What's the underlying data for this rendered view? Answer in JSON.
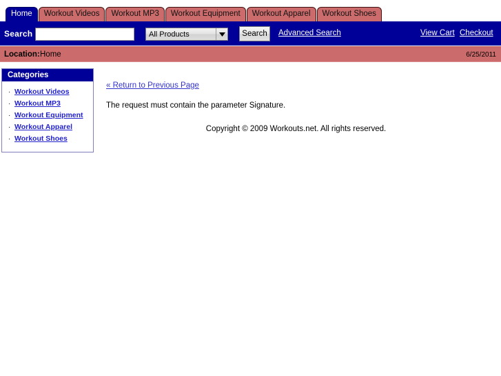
{
  "colors": {
    "navy": "#000099",
    "rose": "#cc6b6b",
    "link_blue": "#2222cc",
    "white": "#ffffff"
  },
  "tabs": [
    {
      "label": "Home",
      "active": true
    },
    {
      "label": "Workout Videos",
      "active": false
    },
    {
      "label": "Workout MP3",
      "active": false
    },
    {
      "label": "Workout Equipment",
      "active": false
    },
    {
      "label": "Workout Apparel",
      "active": false
    },
    {
      "label": "Workout Shoes",
      "active": false
    }
  ],
  "search": {
    "label": "Search",
    "input_value": "",
    "input_placeholder": "",
    "category_selected": "All Products",
    "category_options": [
      "All Products"
    ],
    "dropdown_icon": "chevron-down-icon",
    "button_label": "Search",
    "advanced_search_label": "Advanced Search",
    "view_cart_label": "View Cart",
    "checkout_label": "Checkout"
  },
  "location": {
    "label": "Location:",
    "value": "Home",
    "date": "6/25/2011"
  },
  "sidebar": {
    "header": "Categories",
    "bullet": "·",
    "items": [
      {
        "label": "Workout Videos"
      },
      {
        "label": "Workout MP3"
      },
      {
        "label": "Workout Equipment"
      },
      {
        "label": "Workout Apparel"
      },
      {
        "label": "Workout Shoes"
      }
    ]
  },
  "main": {
    "return_link": "« Return to Previous Page",
    "error_message": "The request must contain the parameter Signature.",
    "copyright": "Copyright © 2009 Workouts.net. All rights reserved."
  }
}
